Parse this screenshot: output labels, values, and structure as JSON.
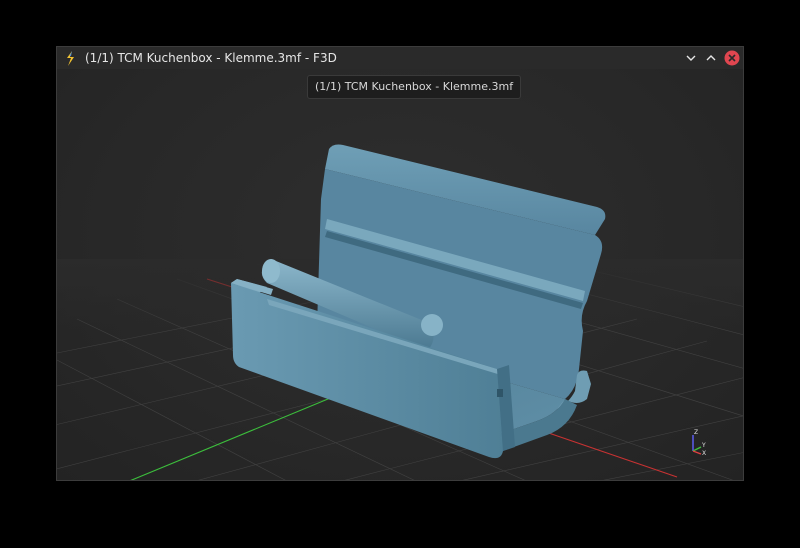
{
  "window": {
    "title": "(1/1) TCM Kuchenbox - Klemme.3mf - F3D",
    "app_icon": "f3d-logo-icon",
    "controls": [
      "minimize-icon",
      "maximize-icon",
      "close-icon"
    ],
    "close_color": "#e04650"
  },
  "viewport": {
    "tooltip": "(1/1) TCM Kuchenbox - Klemme.3mf",
    "background_color": "#2b2b2b",
    "model_color": "#5a8aa0",
    "grid": true,
    "grid_x_axis_color": "#c83232",
    "grid_z_axis_color": "#3cbe3c",
    "axes_widget": {
      "labels": [
        "Z",
        "Y",
        "X"
      ]
    }
  }
}
